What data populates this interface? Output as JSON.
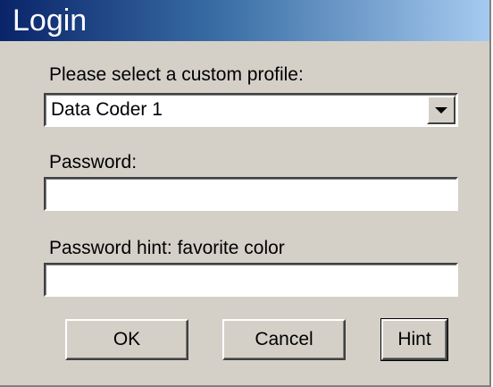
{
  "window": {
    "title": "Login"
  },
  "profile": {
    "label": "Please select a custom profile:",
    "selected": "Data Coder 1"
  },
  "password": {
    "label": "Password:",
    "value": ""
  },
  "hint": {
    "label": "Password hint: favorite color",
    "value": ""
  },
  "buttons": {
    "ok": "OK",
    "cancel": "Cancel",
    "hint": "Hint"
  },
  "icons": {
    "dropdown": "chevron-down-icon"
  },
  "colors": {
    "face": "#d4d0c8",
    "title_start": "#0a246a",
    "title_end": "#a6caf0"
  }
}
